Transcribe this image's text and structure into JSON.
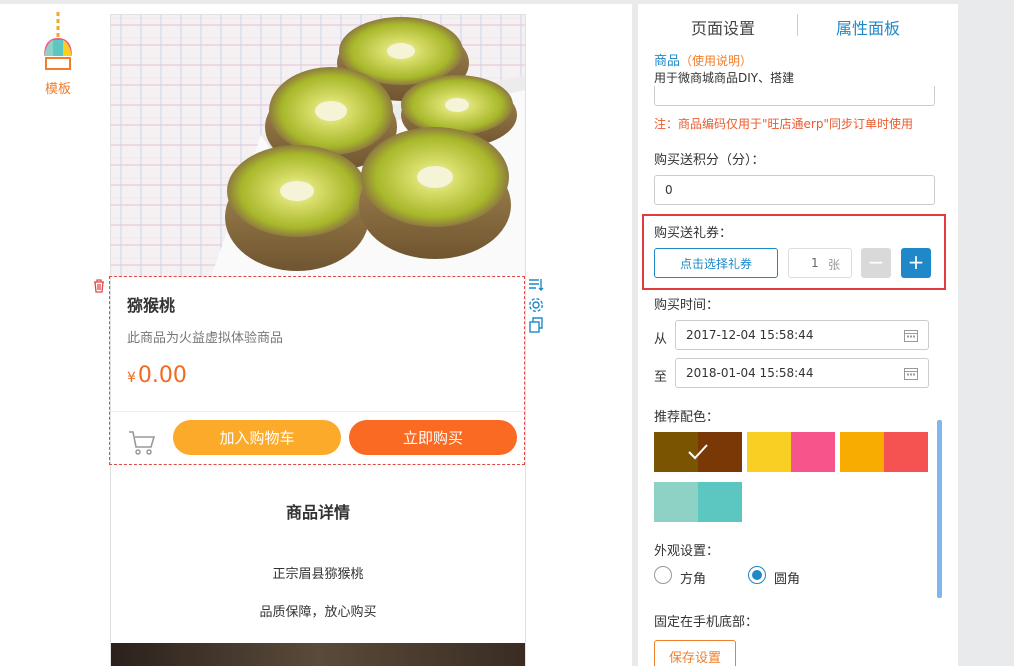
{
  "left": {
    "template_label": "模板"
  },
  "product": {
    "title": "猕猴桃",
    "description": "此商品为火益虚拟体验商品",
    "currency": "¥",
    "price": "0.00",
    "add_cart_label": "加入购物车",
    "buy_now_label": "立即购买"
  },
  "detail": {
    "title": "商品详情",
    "line1": "正宗眉县猕猴桃",
    "line2": "品质保障，放心购买"
  },
  "panel": {
    "tab_page": "页面设置",
    "tab_attr": "属性面板",
    "module_name": "商品",
    "usage_link": "（使用说明）",
    "module_desc": "用于微商城商品DIY、搭建",
    "code_note": "注：商品编码仅用于\"旺店通erp\"同步订单时使用",
    "points_label": "购买送积分（分）：",
    "points_value": "0",
    "coupon_label": "购买送礼券：",
    "coupon_button": "点击选择礼券",
    "coupon_qty": "1",
    "coupon_unit": "张",
    "minus": "−",
    "plus": "+",
    "time_label": "购买时间：",
    "from_label": "从",
    "from_value": "2017-12-04 15:58:44",
    "to_label": "至",
    "to_value": "2018-01-04 15:58:44",
    "color_label": "推荐配色：",
    "swatches": [
      {
        "left": "#7b5401",
        "right": "#7a3806",
        "selected": true
      },
      {
        "left": "#f8cf22",
        "right": "#f5558a",
        "selected": false
      },
      {
        "left": "#f8ab00",
        "right": "#f55252",
        "selected": false
      },
      {
        "left": "#8ed2c6",
        "right": "#5cc6c1",
        "selected": false
      }
    ],
    "appearance_label": "外观设置：",
    "square_label": "方角",
    "round_label": "圆角",
    "fixed_label": "固定在手机底部：",
    "save_label": "保存设置"
  },
  "colors": {
    "accent_blue": "#1e88c8",
    "accent_orange": "#f07f2d",
    "cart_button": "#fbaa2a",
    "buy_button": "#fb6a23",
    "highlight_border": "#e33b3b"
  },
  "icons": [
    "template-icon",
    "trash-icon",
    "sort-icon",
    "settings-icon",
    "copy-icon",
    "cart-icon",
    "calendar-icon",
    "check-icon"
  ]
}
